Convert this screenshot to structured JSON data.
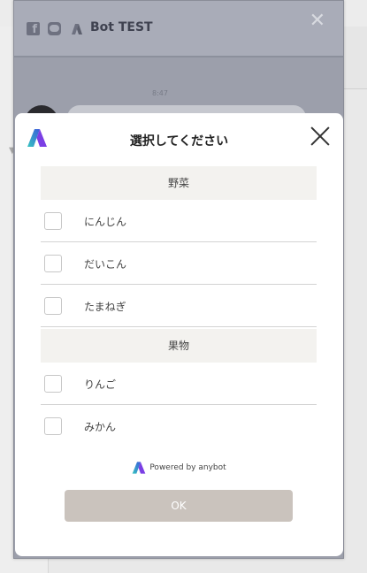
{
  "chat": {
    "title": "Bot TEST",
    "time": "8:47"
  },
  "modal": {
    "title": "選択してください",
    "categories": [
      {
        "label": "野菜",
        "options": [
          "にんじん",
          "だいこん",
          "たまねぎ"
        ]
      },
      {
        "label": "果物",
        "options": [
          "りんご",
          "みかん"
        ]
      }
    ],
    "powered_by": "Powered by anybot",
    "ok_label": "OK"
  },
  "icons": {
    "header": [
      "facebook-icon",
      "line-icon",
      "anybot-icon"
    ],
    "close": "close-icon",
    "logo": "anybot-logo-icon"
  },
  "colors": {
    "ok_button": "#cac3bd",
    "category_bg": "#f3f2ef",
    "logo_blue": "#3b5bdb",
    "logo_teal": "#36c5c0",
    "logo_purple": "#7b3fe4"
  }
}
